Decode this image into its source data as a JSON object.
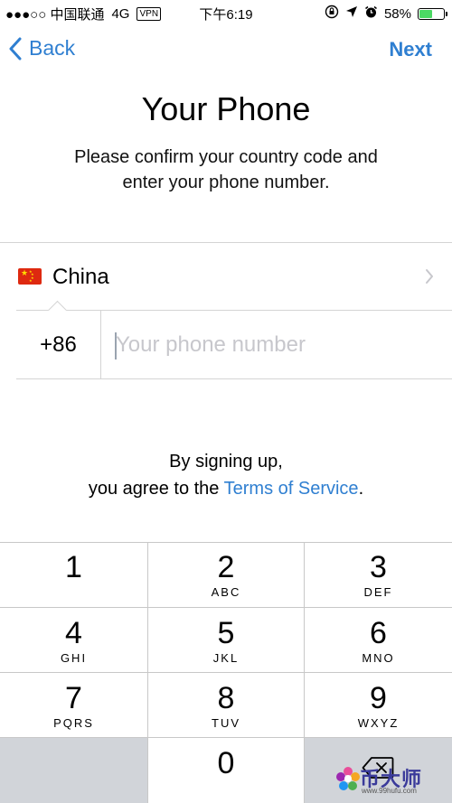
{
  "status_bar": {
    "carrier": "●●●○○ 中国联通",
    "network": "4G",
    "vpn": "VPN",
    "time": "下午6:19",
    "battery_percent": "58%",
    "battery_level": 0.58,
    "battery_color": "#4cd964"
  },
  "nav": {
    "back_label": "Back",
    "next_label": "Next",
    "accent_color": "#2f7fd1"
  },
  "title": "Your Phone",
  "subtitle": "Please confirm your country code and enter your phone number.",
  "country": {
    "flag_icon": "china-flag-icon",
    "name": "China"
  },
  "phone": {
    "country_code": "+86",
    "value": "",
    "placeholder": "Your phone number"
  },
  "terms": {
    "line1": "By signing up,",
    "line2_prefix": "you agree to the ",
    "link_text": "Terms of Service",
    "line2_suffix": "."
  },
  "keypad": {
    "keys": [
      {
        "digit": "1",
        "letters": ""
      },
      {
        "digit": "2",
        "letters": "ABC"
      },
      {
        "digit": "3",
        "letters": "DEF"
      },
      {
        "digit": "4",
        "letters": "GHI"
      },
      {
        "digit": "5",
        "letters": "JKL"
      },
      {
        "digit": "6",
        "letters": "MNO"
      },
      {
        "digit": "7",
        "letters": "PQRS"
      },
      {
        "digit": "8",
        "letters": "TUV"
      },
      {
        "digit": "9",
        "letters": "WXYZ"
      },
      {
        "digit": "0",
        "letters": ""
      }
    ],
    "backspace_icon": "backspace-icon"
  },
  "watermark": {
    "text": "币大师",
    "url": "www.99hufu.com"
  }
}
